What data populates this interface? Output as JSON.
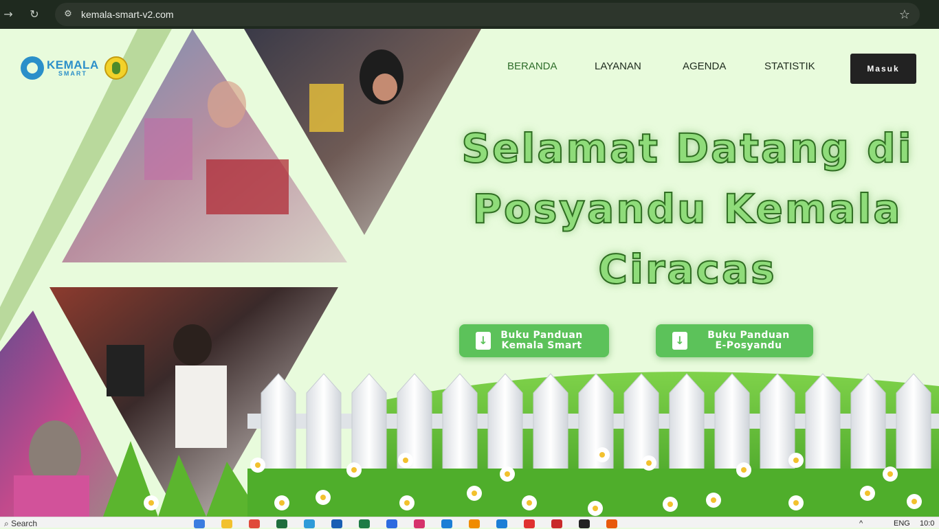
{
  "browser": {
    "url": "kemala-smart-v2.com",
    "icons": [
      "forward-icon",
      "reload-icon",
      "site-info-icon",
      "bookmark-star-icon"
    ]
  },
  "logo": {
    "name": "KEMALA",
    "sub": "SMART"
  },
  "nav": {
    "items": [
      {
        "label": "BERANDA",
        "active": true
      },
      {
        "label": "LAYANAN",
        "active": false
      },
      {
        "label": "AGENDA",
        "active": false
      },
      {
        "label": "STATISTIK",
        "active": false
      }
    ],
    "login_label": "Masuk"
  },
  "hero": {
    "line1": "Selamat Datang di",
    "line2": "Posyandu Kemala",
    "line3": "Ciracas"
  },
  "buttons": {
    "guide1_line1": "Buku Panduan",
    "guide1_line2": "Kemala Smart",
    "guide2_line1": "Buku Panduan",
    "guide2_line2": "E-Posyandu"
  },
  "taskbar": {
    "search": "Search",
    "lang": "ENG",
    "time": "10:0"
  },
  "colors": {
    "page_bg": "#e8fbdc",
    "accent_green": "#5cc25a",
    "title_fill": "#8fdc7a",
    "title_stroke": "#2f6d22",
    "login_bg": "#222222",
    "logo_blue": "#2b8fc9"
  }
}
